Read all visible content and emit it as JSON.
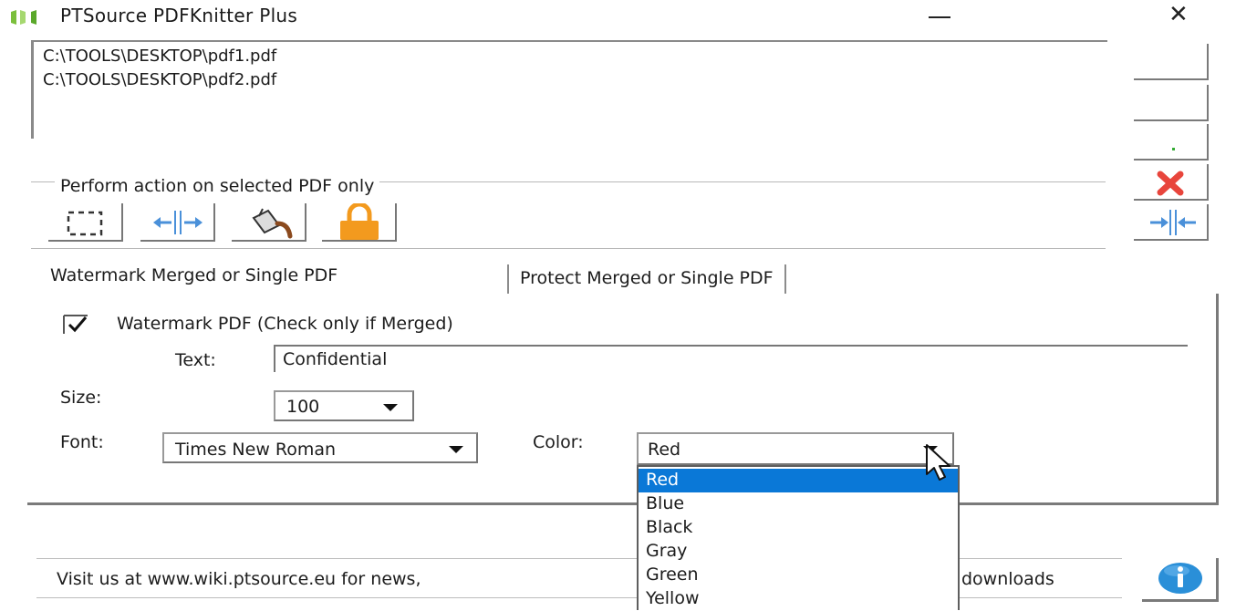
{
  "window": {
    "title": "PTSource PDFKnitter Plus",
    "minimize_icon": "minimize-icon",
    "close_icon": "close-icon",
    "close_glyph": "✕"
  },
  "file_list": {
    "items": [
      "C:\\TOOLS\\DESKTOP\\pdf1.pdf",
      "C:\\TOOLS\\DESKTOP\\pdf2.pdf"
    ]
  },
  "side_buttons": {
    "icons": [
      "blank",
      "blank",
      "blank",
      "delete-x-icon",
      "merge-arrows-icon"
    ]
  },
  "selected_actions": {
    "label": "Perform action on selected PDF only",
    "icons": [
      "select-region-icon",
      "split-arrows-icon",
      "paint-bucket-icon",
      "padlock-icon"
    ]
  },
  "tabs": [
    {
      "label": "Watermark Merged or Single PDF",
      "active": true
    },
    {
      "label": "Protect Merged or Single PDF",
      "active": false
    }
  ],
  "watermark": {
    "checkbox_label": "Watermark PDF (Check only if Merged)",
    "checked": true,
    "text_label": "Text:",
    "text_value": "Confidential",
    "size_label": "Size:",
    "size_value": "100",
    "font_label": "Font:",
    "font_value": "Times New Roman",
    "color_label": "Color:",
    "color_value": "Red"
  },
  "color_dropdown": {
    "options": [
      "Red",
      "Blue",
      "Black",
      "Gray",
      "Green",
      "Yellow"
    ],
    "selected": "Red"
  },
  "footer": {
    "text_left": "Visit us at www.wiki.ptsource.eu for news,",
    "text_right": "downloads",
    "info_icon": "info-icon"
  },
  "colors": {
    "selection": "#0a78d7",
    "delete_red": "#e8453c",
    "lock_orange": "#f39a1e",
    "arrow_blue": "#4a90d9"
  }
}
